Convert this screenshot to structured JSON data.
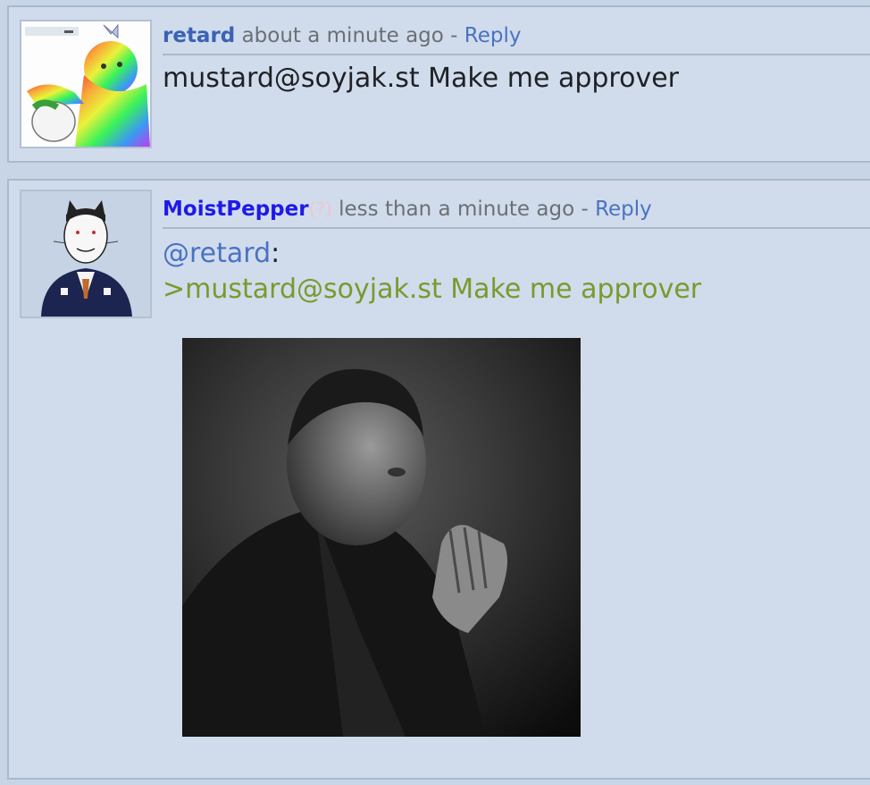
{
  "comments": [
    {
      "username": "retard",
      "time": "about a minute ago",
      "separator": "-",
      "reply_label": "Reply",
      "body_text": "mustard@soyjak.st Make me approver",
      "avatar_icon": "rainbow-wojak-avatar"
    },
    {
      "username": "MoistPepper",
      "flair": "(?)",
      "time": "less than a minute ago",
      "separator": "-",
      "reply_label": "Reply",
      "mention": "@retard",
      "mention_suffix": ":",
      "quote_text": ">mustard@soyjak.st Make me approver",
      "avatar_icon": "cat-suit-avatar",
      "attachment_icon": "praying-man-photo"
    }
  ],
  "colors": {
    "background": "#c8d5e6",
    "comment_bg": "#d0dcec",
    "border": "#a9b9cc",
    "link_blue": "#4a72c4",
    "username_strong": "#1f1ae6",
    "greentext": "#7a9a2e"
  }
}
